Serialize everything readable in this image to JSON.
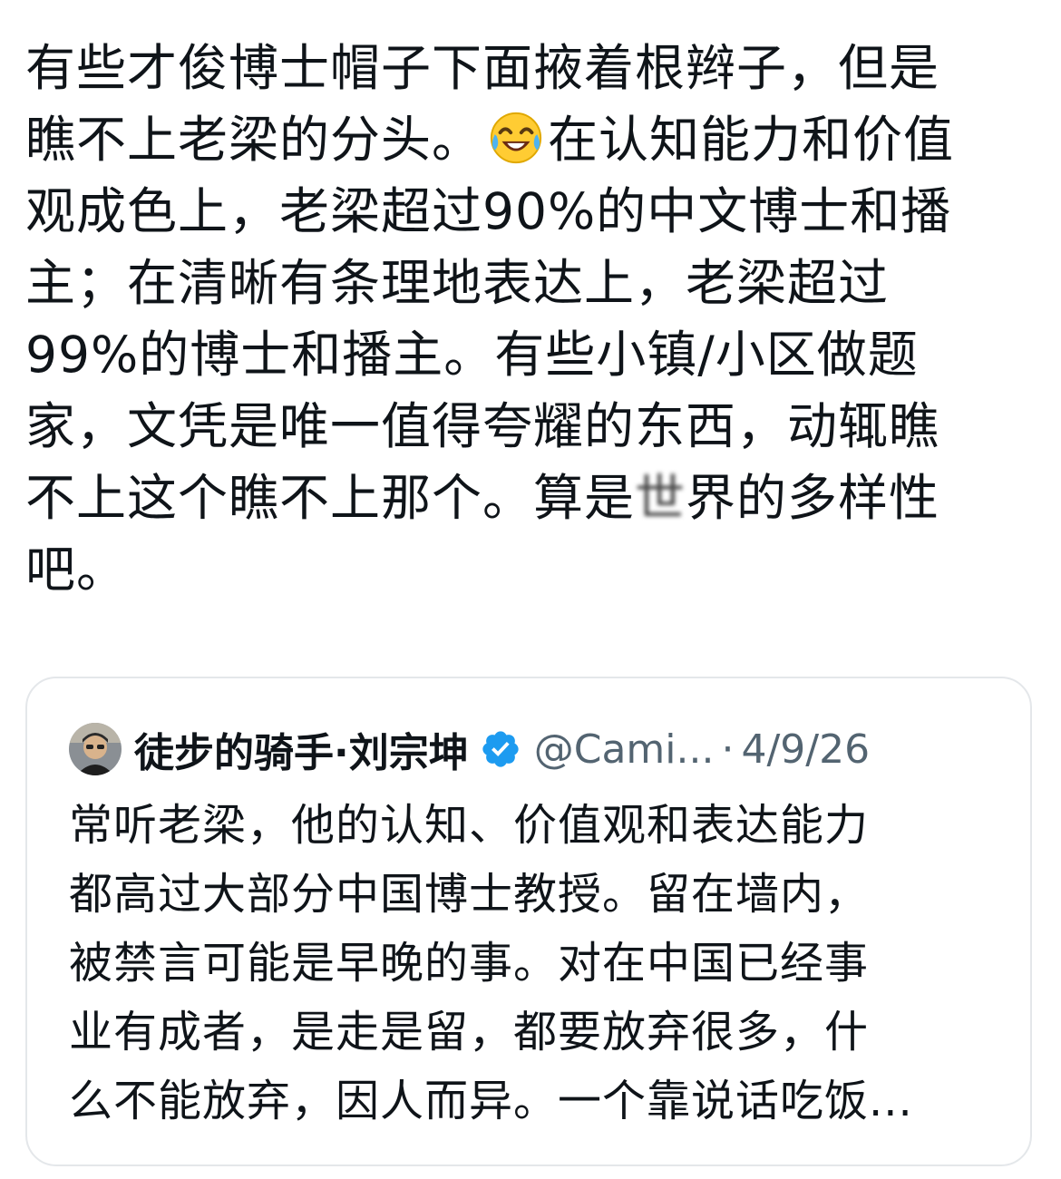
{
  "post": {
    "lines": [
      "有些才俊博士帽子下面掖着根辫子，但是",
      "瞧不上老梁的分头。",
      "在认知能力和价值",
      "观成色上，老梁超过90%的中文博士和播",
      "主；在清晰有条理地表达上，老梁超过",
      "99%的博士和播主。有些小镇/小区做题",
      "家，文凭是唯一值得夸耀的东西，动辄瞧",
      "不上这个瞧不上那个。算是",
      "世",
      "界的多样性",
      "吧。"
    ],
    "emoji_icon": "face-with-tears-of-joy-icon"
  },
  "quote": {
    "author_name": "徒步的骑手·刘宗坤",
    "handle": "@Cami...",
    "separator": "·",
    "date": "4/9/26",
    "lines": [
      "常听老梁，他的认知、价值观和表达能力",
      "都高过大部分中国博士教授。留在墙内，",
      "被禁言可能是早晚的事。对在中国已经事",
      "业有成者，是走是留，都要放弃很多，什",
      "么不能放弃，因人而异。一个靠说话吃饭..."
    ],
    "verified_icon": "verified-badge-icon",
    "avatar_icon": "avatar"
  },
  "colors": {
    "text": "#0f1419",
    "secondary": "#536471",
    "verified": "#1d9bf0",
    "card_border": "#e4e7ea"
  }
}
